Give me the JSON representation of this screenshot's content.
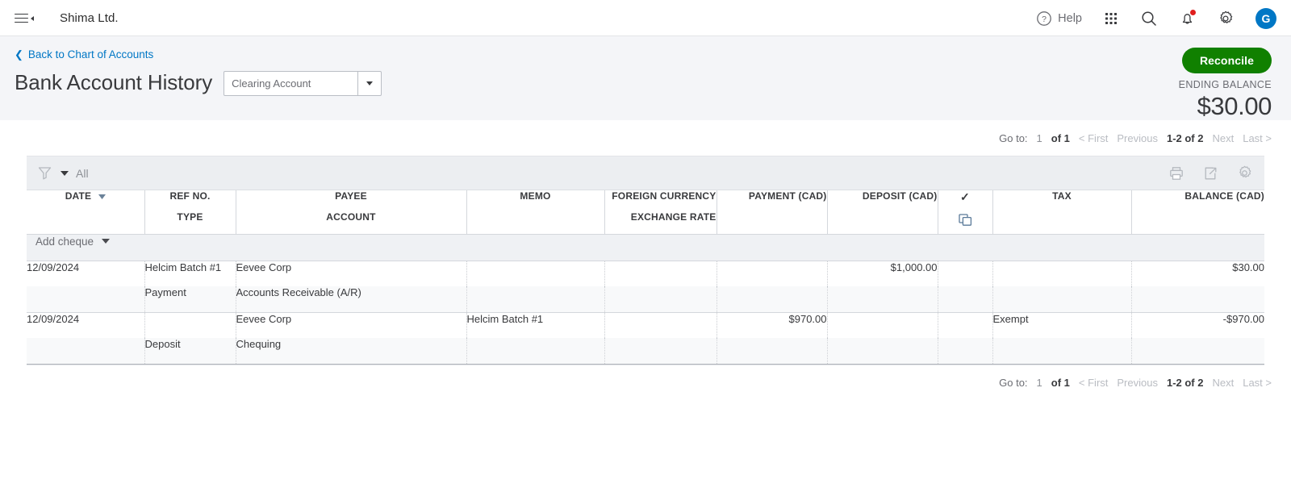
{
  "topnav": {
    "menu_icon": "hamburger-icon",
    "company": "Shima Ltd.",
    "help_label": "Help",
    "help_icon": "question-circle-icon",
    "grid_icon": "apps-grid-icon",
    "search_icon": "search-icon",
    "bell_icon": "notification-bell-icon",
    "gear_icon": "gear-icon",
    "avatar_initial": "G",
    "avatar_color": "#0077c5"
  },
  "header": {
    "back_link": "Back to Chart of Accounts",
    "back_icon": "chevron-left-icon",
    "title": "Bank Account History",
    "account_value": "Clearing Account",
    "account_caret_icon": "chevron-down-icon",
    "reconcile_label": "Reconcile",
    "reconcile_color": "#108000",
    "ending_balance_label": "ENDING BALANCE",
    "ending_balance_amount": "$30.00"
  },
  "pagination": {
    "goto_label": "Go to:",
    "page_number": "1",
    "of_pages": "of 1",
    "first": "< First",
    "previous": "Previous",
    "range": "1-2 of 2",
    "next": "Next",
    "last": "Last >"
  },
  "toolbar": {
    "filter_icon": "funnel-filter-icon",
    "filter_caret_icon": "chevron-down-icon",
    "filter_label": "All",
    "print_icon": "printer-icon",
    "export_icon": "export-icon",
    "settings_icon": "gear-icon"
  },
  "table": {
    "columns": [
      {
        "line1": "DATE",
        "line2": "",
        "align": "left",
        "sort_icon": "sort-desc-icon"
      },
      {
        "line1": "REF NO.",
        "line2": "TYPE",
        "align": "left"
      },
      {
        "line1": "PAYEE",
        "line2": "ACCOUNT",
        "align": "left"
      },
      {
        "line1": "MEMO",
        "line2": "",
        "align": "left"
      },
      {
        "line1": "FOREIGN CURRENCY",
        "line2": "EXCHANGE RATE",
        "align": "right"
      },
      {
        "line1": "PAYMENT (CAD)",
        "line2": "",
        "align": "right"
      },
      {
        "line1": "DEPOSIT (CAD)",
        "line2": "",
        "align": "right"
      },
      {
        "line1": "✓",
        "line2": "",
        "align": "center",
        "icon2": "duplicate-copy-icon"
      },
      {
        "line1": "TAX",
        "line2": "",
        "align": "left"
      },
      {
        "line1": "BALANCE (CAD)",
        "line2": "",
        "align": "right"
      }
    ],
    "add_row": {
      "label": "Add cheque",
      "caret_icon": "chevron-down-icon"
    },
    "rows": [
      {
        "line1": {
          "date": "12/09/2024",
          "ref": "Helcim Batch #1",
          "payee": "Eevee Corp",
          "memo": "",
          "foreign_currency": "",
          "payment": "",
          "deposit": "$1,000.00",
          "check": "",
          "tax": "",
          "balance": "$30.00",
          "balance_negative": false
        },
        "line2": {
          "date": "",
          "type": "Payment",
          "account": "Accounts Receivable (A/R)",
          "memo": "",
          "exchange_rate": "",
          "payment": "",
          "deposit": "",
          "check": "",
          "tax": "",
          "balance": ""
        }
      },
      {
        "line1": {
          "date": "12/09/2024",
          "ref": "",
          "payee": "Eevee Corp",
          "memo": "Helcim Batch #1",
          "foreign_currency": "",
          "payment": "$970.00",
          "deposit": "",
          "check": "",
          "tax": "Exempt",
          "balance": "-$970.00",
          "balance_negative": true
        },
        "line2": {
          "date": "",
          "type": "Deposit",
          "account": "Chequing",
          "memo": "",
          "exchange_rate": "",
          "payment": "",
          "deposit": "",
          "check": "",
          "tax": "",
          "balance": ""
        }
      }
    ]
  }
}
